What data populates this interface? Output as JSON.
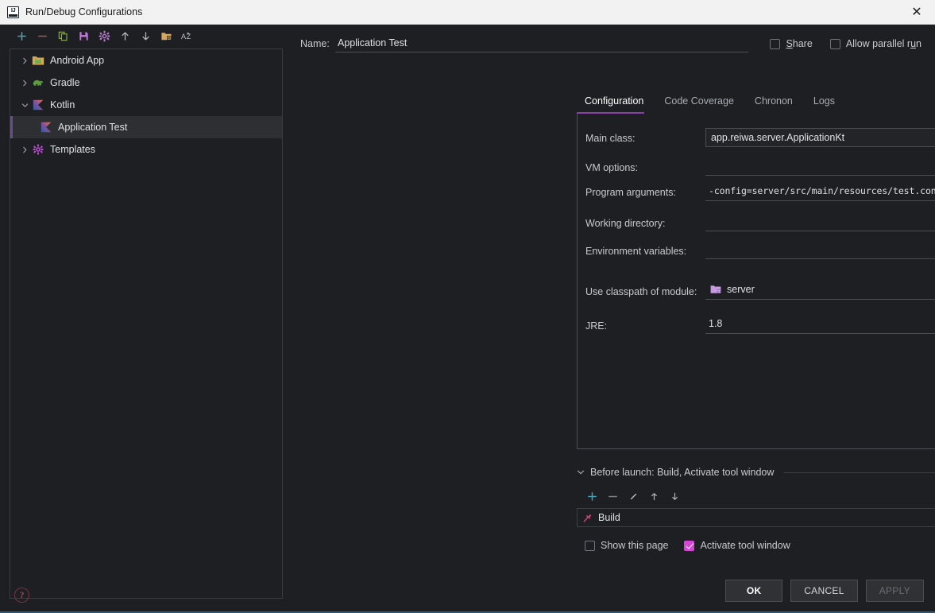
{
  "window": {
    "title": "Run/Debug Configurations",
    "app_icon": "intellij-idea-icon",
    "close_label": "✕"
  },
  "tree_toolbar": {
    "buttons": [
      {
        "name": "add-configuration-button",
        "icon": "plus-icon",
        "color": "#46a0b8"
      },
      {
        "name": "remove-configuration-button",
        "icon": "minus-icon",
        "color": "#a8535a"
      },
      {
        "name": "copy-configuration-button",
        "icon": "copy-icon",
        "color": "#8fae5a"
      },
      {
        "name": "save-configuration-button",
        "icon": "save-icon",
        "color": "#c07ad8"
      },
      {
        "name": "edit-templates-button",
        "icon": "gear-icon",
        "color": "#c07ad8"
      },
      {
        "name": "move-up-button",
        "icon": "arrow-up-icon",
        "color": "#b9bdc4"
      },
      {
        "name": "move-down-button",
        "icon": "arrow-down-icon",
        "color": "#b9bdc4"
      },
      {
        "name": "new-folder-button",
        "icon": "folder-add-icon",
        "color": "#d8a85a"
      },
      {
        "name": "sort-alphabetically-button",
        "icon": "sort-az-icon",
        "color": "#b9bdc4"
      }
    ]
  },
  "tree": {
    "items": [
      {
        "label": "Android App",
        "icon": "android-folder-icon",
        "expanded": false,
        "level": 0,
        "selected": false
      },
      {
        "label": "Gradle",
        "icon": "gradle-elephant-icon",
        "expanded": false,
        "level": 0,
        "selected": false
      },
      {
        "label": "Kotlin",
        "icon": "kotlin-icon",
        "expanded": true,
        "level": 0,
        "selected": false
      },
      {
        "label": "Application Test",
        "icon": "kotlin-icon",
        "expanded": null,
        "level": 1,
        "selected": true
      },
      {
        "label": "Templates",
        "icon": "gear-icon",
        "expanded": false,
        "level": 0,
        "selected": false
      }
    ]
  },
  "header": {
    "name_label": "Name:",
    "name_value": "Application Test",
    "share": {
      "label_before": "",
      "mnemonic": "S",
      "label_after": "hare",
      "checked": false
    },
    "parallel": {
      "label_before": "Allow parallel r",
      "mnemonic": "u",
      "label_after": "n",
      "checked": false
    }
  },
  "tabs": {
    "items": [
      {
        "label": "Configuration",
        "active": true
      },
      {
        "label": "Code Coverage",
        "active": false
      },
      {
        "label": "Chronon",
        "active": false
      },
      {
        "label": "Logs",
        "active": false
      }
    ]
  },
  "form": {
    "main_class": {
      "label": "Main class:",
      "value": "app.reiwa.server.ApplicationKt",
      "browse": "..."
    },
    "vm_options": {
      "label": "VM options:",
      "value": "",
      "add_icon": "plus-icon",
      "expand_icon": "expand-icon"
    },
    "program_arguments": {
      "label": "Program arguments:",
      "value": "-config=server/src/main/resources/test.conf",
      "expand_icon": "expand-icon"
    },
    "working_directory": {
      "label": "Working directory:",
      "value": "",
      "caret": "▾",
      "browse": "..."
    },
    "environment_vars": {
      "label": "Environment variables:",
      "value": "",
      "macro_icon": "dollar-macro-icon"
    },
    "classpath_module": {
      "label": "Use classpath of module:",
      "value": "server",
      "icon": "module-folder-icon",
      "caret": "▾"
    },
    "jre": {
      "label": "JRE:",
      "value": "1.8",
      "caret": "▾",
      "browse": "..."
    }
  },
  "before_launch": {
    "header": "Before launch: Build, Activate tool window",
    "collapse_icon": "chevron-down-icon",
    "toolbar": [
      {
        "name": "add-task-button",
        "icon": "plus-icon",
        "color": "#46a0b8"
      },
      {
        "name": "remove-task-button",
        "icon": "minus-icon",
        "color": "#7d8086"
      },
      {
        "name": "edit-task-button",
        "icon": "pencil-icon",
        "color": "#b9bdc4"
      },
      {
        "name": "move-task-up-button",
        "icon": "arrow-up-icon",
        "color": "#b9bdc4"
      },
      {
        "name": "move-task-down-button",
        "icon": "arrow-down-icon",
        "color": "#b9bdc4"
      }
    ],
    "tasks": [
      {
        "label": "Build",
        "icon": "build-hammer-icon"
      }
    ],
    "show_page": {
      "label": "Show this page",
      "checked": false
    },
    "activate_tw": {
      "label": "Activate tool window",
      "checked": true
    }
  },
  "footer": {
    "help_icon": "help-question-icon",
    "ok": "OK",
    "cancel": "CANCEL",
    "apply": "APPLY",
    "apply_disabled": true
  },
  "colors": {
    "accent_purple": "#8b3fa8",
    "checkbox_checked": "#d844d8",
    "selection_bar": "#6e4a8e",
    "bottom_accent": "#2b5a86"
  }
}
